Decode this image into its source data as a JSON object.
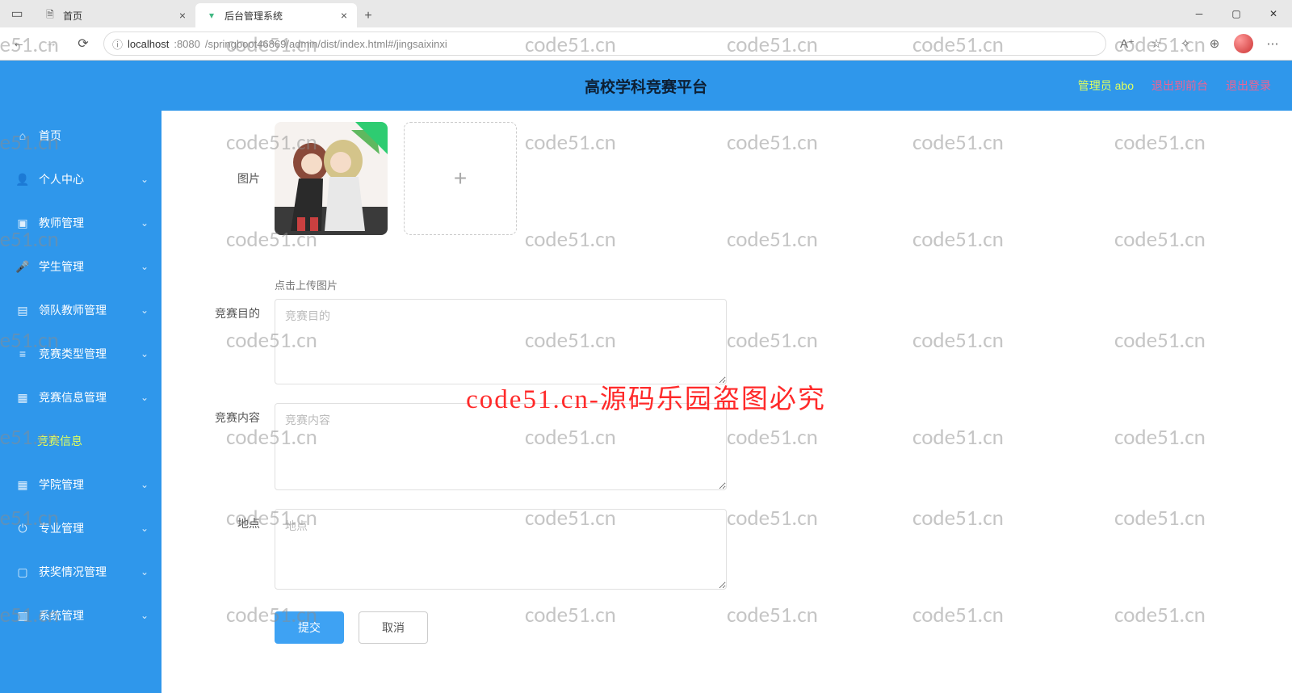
{
  "browser": {
    "tabs": [
      {
        "title": "首页",
        "active": false
      },
      {
        "title": "后台管理系统",
        "active": true
      }
    ],
    "url_host": "localhost",
    "url_port": ":8080",
    "url_path": "/springboot46869/admin/dist/index.html#/jingsaixinxi"
  },
  "header": {
    "title": "高校学科竞赛平台",
    "admin": "管理员 abo",
    "to_front": "退出到前台",
    "logout": "退出登录"
  },
  "sidebar": {
    "items": [
      {
        "label": "首页",
        "icon": "home",
        "expandable": false
      },
      {
        "label": "个人中心",
        "icon": "user",
        "expandable": true
      },
      {
        "label": "教师管理",
        "icon": "teacher",
        "expandable": true
      },
      {
        "label": "学生管理",
        "icon": "mic",
        "expandable": true
      },
      {
        "label": "领队教师管理",
        "icon": "leader",
        "expandable": true
      },
      {
        "label": "竞赛类型管理",
        "icon": "list",
        "expandable": true
      },
      {
        "label": "竞赛信息管理",
        "icon": "info",
        "expandable": true,
        "expanded": true,
        "children": [
          {
            "label": "竞赛信息",
            "active": true
          }
        ]
      },
      {
        "label": "学院管理",
        "icon": "grid",
        "expandable": true
      },
      {
        "label": "专业管理",
        "icon": "power",
        "expandable": true
      },
      {
        "label": "获奖情况管理",
        "icon": "award",
        "expandable": true
      },
      {
        "label": "系统管理",
        "icon": "system",
        "expandable": true
      }
    ]
  },
  "form": {
    "image_label": "图片",
    "upload_hint": "点击上传图片",
    "purpose_label": "竞赛目的",
    "purpose_placeholder": "竞赛目的",
    "content_label": "竞赛内容",
    "content_placeholder": "竞赛内容",
    "place_label": "地点",
    "place_placeholder": "地点",
    "submit": "提交",
    "cancel": "取消"
  },
  "watermark": {
    "text": "code51.cn",
    "center": "code51.cn-源码乐园盗图必究"
  }
}
